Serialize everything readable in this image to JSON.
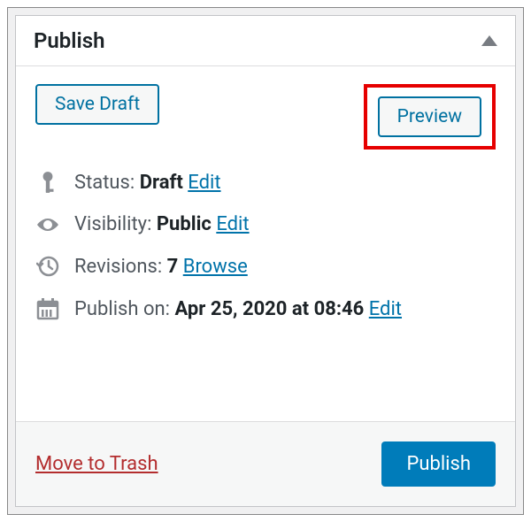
{
  "panel": {
    "title": "Publish",
    "save_draft_label": "Save Draft",
    "preview_label": "Preview",
    "status": {
      "label": "Status:",
      "value": "Draft",
      "edit_label": "Edit"
    },
    "visibility": {
      "label": "Visibility:",
      "value": "Public",
      "edit_label": "Edit"
    },
    "revisions": {
      "label": "Revisions:",
      "value": "7",
      "browse_label": "Browse"
    },
    "publish_on": {
      "label": "Publish on:",
      "value": "Apr 25, 2020 at 08:46",
      "edit_label": "Edit"
    },
    "trash_label": "Move to Trash",
    "publish_button_label": "Publish"
  }
}
